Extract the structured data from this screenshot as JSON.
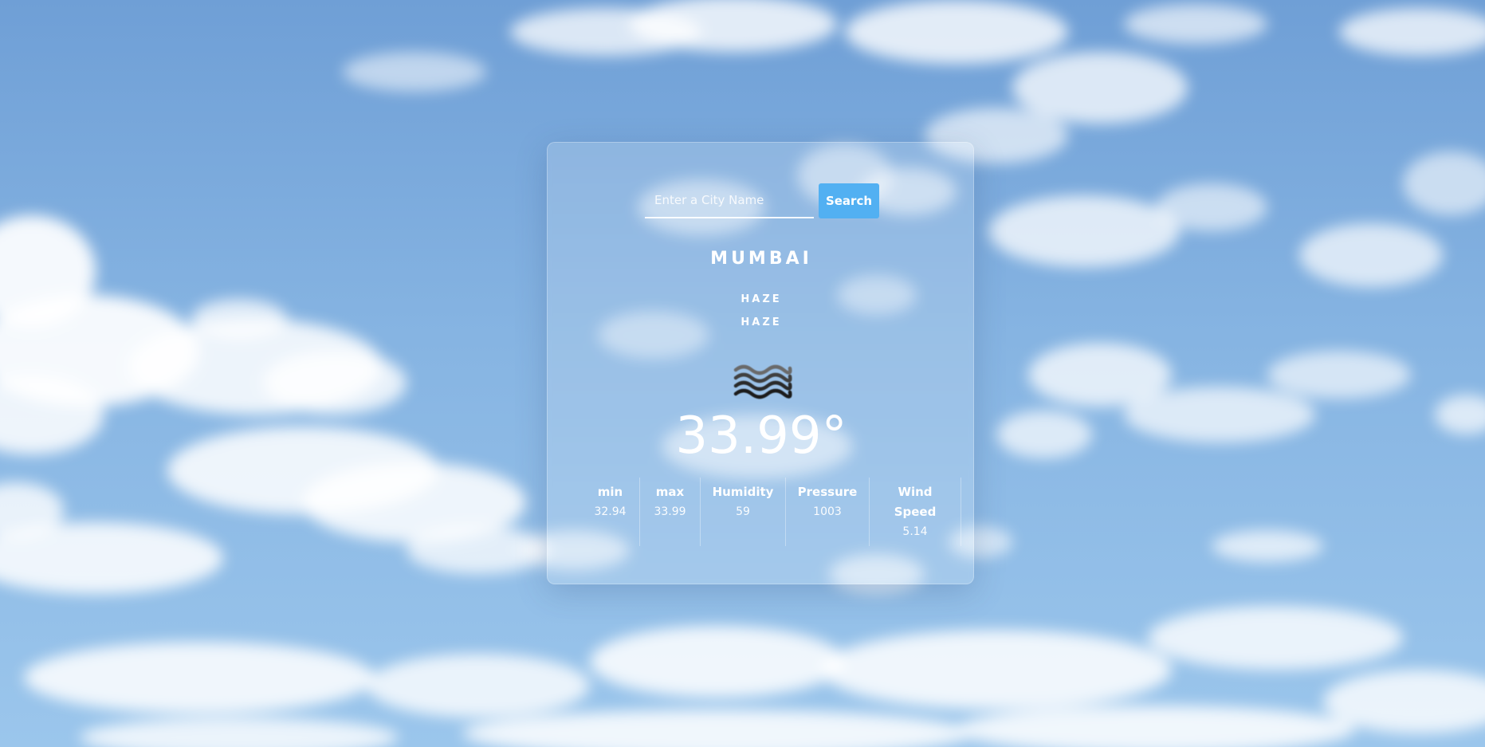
{
  "search": {
    "placeholder": "Enter a City Name",
    "value": "",
    "button_label": "Search"
  },
  "weather": {
    "city": "MUMBAI",
    "condition_main": "HAZE",
    "condition_description": "HAZE",
    "icon": "haze-icon",
    "temperature": "33.99°"
  },
  "stats": [
    {
      "label_line1": "min",
      "label_line2": "",
      "value": "32.94"
    },
    {
      "label_line1": "max",
      "label_line2": "",
      "value": "33.99"
    },
    {
      "label_line1": "Humidity",
      "label_line2": "",
      "value": "59"
    },
    {
      "label_line1": "Pressure",
      "label_line2": "",
      "value": "1003"
    },
    {
      "label_line1": "Wind",
      "label_line2": "Speed",
      "value": "5.14"
    }
  ],
  "colors": {
    "accent": "#52b0f2",
    "text": "#ffffff",
    "sky": "#86b4e2"
  }
}
